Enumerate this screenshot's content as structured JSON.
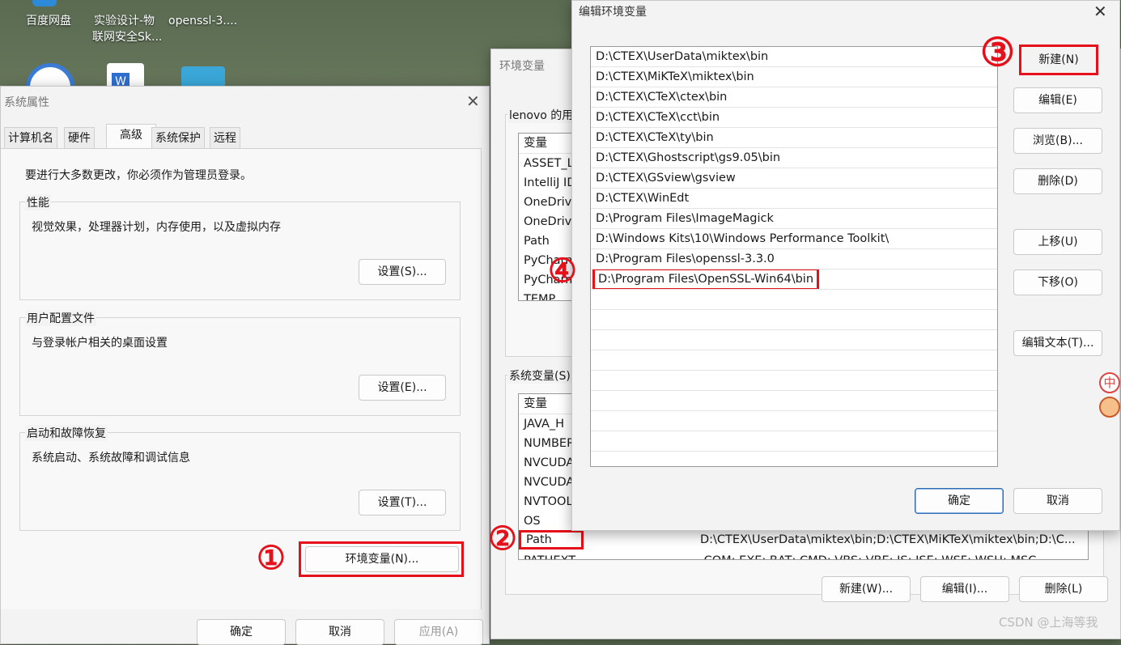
{
  "desktop": {
    "icons": [
      {
        "label_line1": "百度网盘",
        "label_line2": ""
      },
      {
        "label_line1": "实验设计-物",
        "label_line2": "联网安全Sk..."
      },
      {
        "label_line1": "openssl-3....",
        "label_line2": ""
      }
    ]
  },
  "sysprops": {
    "title": "系统属性",
    "tabs": [
      "计算机名",
      "硬件",
      "高级",
      "系统保护",
      "远程"
    ],
    "admin_note": "要进行大多数更改，你必须作为管理员登录。",
    "groups": [
      {
        "title": "性能",
        "desc": "视觉效果，处理器计划，内存使用，以及虚拟内存",
        "button": "设置(S)..."
      },
      {
        "title": "用户配置文件",
        "desc": "与登录帐户相关的桌面设置",
        "button": "设置(E)..."
      },
      {
        "title": "启动和故障恢复",
        "desc": "系统启动、系统故障和调试信息",
        "button": "设置(T)..."
      }
    ],
    "env_button": "环境变量(N)...",
    "ok": "确定",
    "cancel": "取消",
    "apply": "应用(A)"
  },
  "envvars": {
    "title": "环境变量",
    "user_group_title": "lenovo 的用",
    "user_header": "变量",
    "user_vars": [
      "ASSET_L",
      "IntelliJ ID",
      "OneDriv",
      "OneDriv",
      "Path",
      "PyCharm",
      "PyCharm",
      "TEMP"
    ],
    "sys_group_title": "系统变量(S)",
    "sys_header": "变量",
    "sys_vars": [
      "JAVA_H",
      "NUMBER",
      "NVCUDA",
      "NVCUDA",
      "NVTOOL",
      "OS"
    ],
    "path_name": "Path",
    "path_value": "D:\\CTEX\\UserData\\miktex\\bin;D:\\CTEX\\MiKTeX\\miktex\\bin;D:\\C...",
    "pathext_name": "PATHEXT",
    "pathext_value": ".COM;.EXE;.BAT;.CMD;.VBS;.VBE;.JS;.JSE;.WSF;.WSH;.MSC",
    "new_button": "新建(W)...",
    "edit_button": "编辑(I)...",
    "delete_button": "删除(L)"
  },
  "editenv": {
    "title": "编辑环境变量",
    "paths": [
      "D:\\CTEX\\UserData\\miktex\\bin",
      "D:\\CTEX\\MiKTeX\\miktex\\bin",
      "D:\\CTEX\\CTeX\\ctex\\bin",
      "D:\\CTEX\\CTeX\\cct\\bin",
      "D:\\CTEX\\CTeX\\ty\\bin",
      "D:\\CTEX\\Ghostscript\\gs9.05\\bin",
      "D:\\CTEX\\GSview\\gsview",
      "D:\\CTEX\\WinEdt",
      "D:\\Program Files\\ImageMagick",
      "D:\\Windows Kits\\10\\Windows Performance Toolkit\\",
      "D:\\Program Files\\openssl-3.3.0",
      "D:\\Program Files\\OpenSSL-Win64\\bin"
    ],
    "buttons": {
      "new": "新建(N)",
      "edit": "编辑(E)",
      "browse": "浏览(B)...",
      "delete": "删除(D)",
      "up": "上移(U)",
      "down": "下移(O)",
      "edit_text": "编辑文本(T)...",
      "ok": "确定",
      "cancel": "取消"
    }
  },
  "annotations": {
    "one": "①",
    "two": "②",
    "three": "③",
    "four": "④"
  },
  "ime": {
    "label": "中"
  },
  "watermark": "CSDN @上海等我",
  "colors": {
    "annotation_red": "#e5101a",
    "primary_border": "#2d6cb5"
  }
}
